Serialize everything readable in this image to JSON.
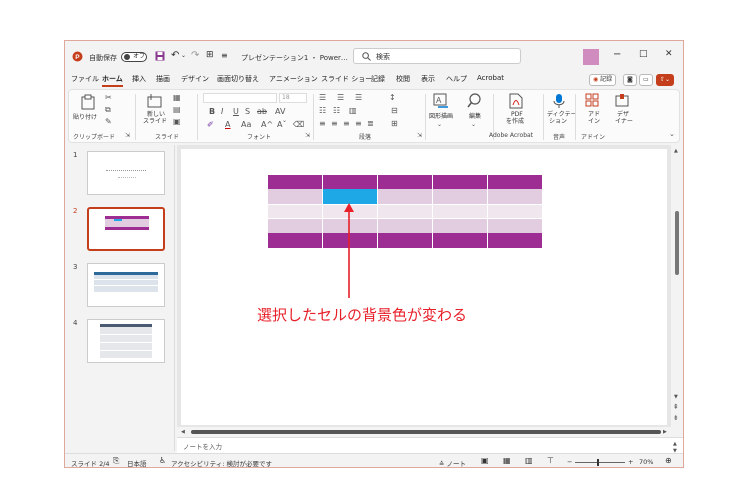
{
  "titlebar": {
    "autosave_label": "自動保存",
    "autosave_state": "オフ",
    "title": "プレゼンテーション1 ・ Power…",
    "search_placeholder": "検索",
    "minimize": "−",
    "maximize": "□",
    "close": "✕"
  },
  "menu": {
    "items": [
      "ファイル",
      "ホーム",
      "挿入",
      "描画",
      "デザイン",
      "画面切り替え",
      "アニメーション",
      "スライド ショー",
      "記録",
      "校閲",
      "表示",
      "ヘルプ",
      "Acrobat"
    ],
    "record_button": "記録"
  },
  "ribbon": {
    "paste": "貼り付け",
    "new_slide_l1": "新しい",
    "new_slide_l2": "スライド",
    "font_size": "18",
    "font_style_b": "B",
    "font_style_i": "I",
    "font_style_u": "U",
    "font_style_s": "S",
    "font_style_ab": "ab",
    "shapes": "図形描画",
    "edit": "編集",
    "pdf_l1": "PDF",
    "pdf_l2": "を作成",
    "dictation_l1": "ディクテー",
    "dictation_l2": "ション",
    "addin_l1": "アド",
    "addin_l2": "イン",
    "designer_l1": "デザ",
    "designer_l2": "イナー",
    "groups": {
      "clipboard": "クリップボード",
      "slides": "スライド",
      "font": "フォント",
      "paragraph": "段落",
      "adobe": "Adobe Acrobat",
      "voice": "音声",
      "addin": "アドイン"
    }
  },
  "thumbnails": {
    "numbers": [
      "1",
      "2",
      "3",
      "4"
    ],
    "selected": 2
  },
  "slide": {
    "table_header_color": "#9e2d93",
    "table_band_1": "#e2cde0",
    "table_band_2": "#efe6ee",
    "selected_cell_color": "#1ea9e6",
    "annotation": "選択したセルの背景色が変わる",
    "annotation_color": "#e8202a"
  },
  "notes_placeholder": "ノートを入力",
  "statusbar": {
    "slide_info": "スライド 2/4",
    "language": "日本語",
    "accessibility": "アクセシビリティ: 検討が必要です",
    "notes_label": "ノート",
    "zoom": "70%"
  }
}
